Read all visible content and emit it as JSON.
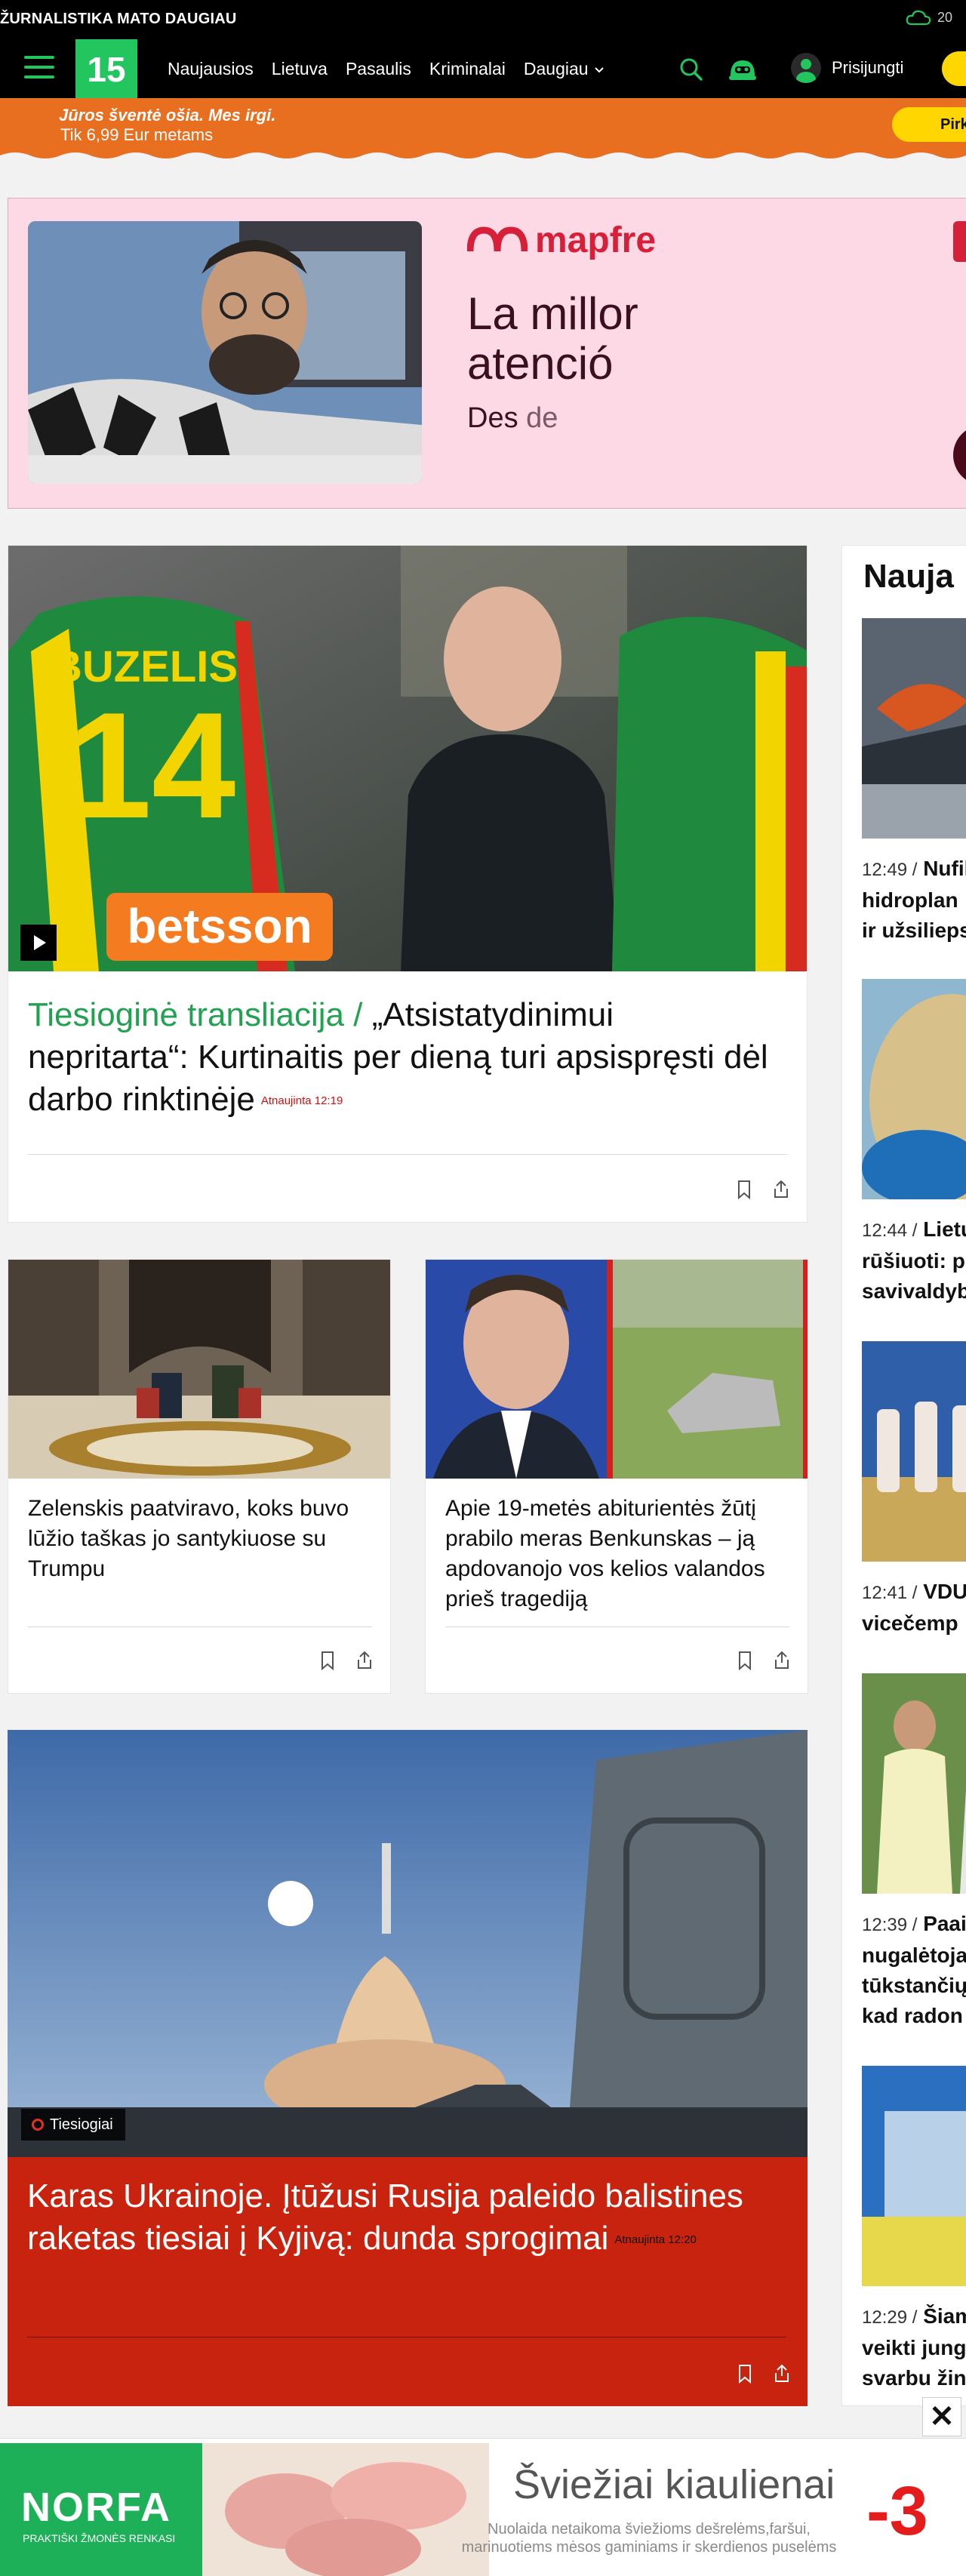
{
  "topbar": {
    "tagline": "ŽURNALISTIKA MATO DAUGIAU",
    "weather_temp": "20"
  },
  "nav": {
    "logo": "15",
    "items": [
      "Naujausios",
      "Lietuva",
      "Pasaulis",
      "Kriminalai",
      "Daugiau"
    ],
    "login": "Prisijungti"
  },
  "promo": {
    "line1": "Jūros šventė ošia. Mes irgi.",
    "line2": "Tik 6,99 Eur metams",
    "cta": "Pirk"
  },
  "ad": {
    "brand": "mapfre",
    "headline_1": "La millor",
    "headline_2": "atenció",
    "desc_1": "Des",
    "desc_2": "de"
  },
  "hero": {
    "live_label": "Tiesioginė transliacija /",
    "title": "„Atsistatydinimui nepritarta“: Kurtinaitis per dieną turi apsispręsti dėl darbo rinktinėje",
    "updated": "Atnaujinta 12:19"
  },
  "sidebar": {
    "title": "Nauja",
    "items": [
      {
        "time": "12:49 /",
        "lines": [
          "Nufil",
          "hidroplan",
          "ir užsilieps"
        ]
      },
      {
        "time": "12:44 /",
        "lines": [
          "Lietu",
          "rūšiuoti: p",
          "savivaldyb"
        ]
      },
      {
        "time": "12:41 /",
        "lines": [
          "VDU",
          "vicečemp"
        ]
      },
      {
        "time": "12:39 /",
        "lines": [
          "Paai",
          "nugalėtoja",
          "tūkstančių",
          "kad radon"
        ]
      },
      {
        "time": "12:29 /",
        "lines": [
          "Šiam",
          "veikti jung",
          "svarbu žin"
        ]
      }
    ]
  },
  "cards": [
    {
      "title": "Zelenskis paatviravo, koks buvo lūžio taškas jo santykiuose su Trumpu"
    },
    {
      "title": "Apie 19-metės abiturientės žūtį prabilo meras Benkunskas – ją apdovanojo vos kelios valandos prieš tragediją"
    }
  ],
  "war": {
    "label": "Tiesiogiai",
    "title": "Karas Ukrainoje. Įtūžusi Rusija paleido balistines raketas tiesiai į Kyjivą: dunda sprogimai",
    "updated": "Atnaujinta 12:20"
  },
  "bottom_ad": {
    "brand": "NORFA",
    "brand_sub": "PRAKTIŠKI ŽMONĖS RENKASI",
    "headline": "Šviežiai kiaulienai",
    "note": "Nuolaida netaikoma šviežioms dešrelėms,faršui, marinuotiems mėsos gaminiams ir skerdienos puselėms",
    "discount": "-3"
  },
  "colors": {
    "brand_green": "#22c55e",
    "live_green": "#22a150",
    "accent_red": "#c8230f",
    "promo_orange": "#e86f1f",
    "cta_yellow": "#ffd600"
  },
  "icons": [
    "menu-icon",
    "search-icon",
    "robot-icon",
    "user-icon",
    "play-icon",
    "bookmark-icon",
    "share-icon",
    "close-icon",
    "cloud-icon",
    "chevron-down-icon"
  ]
}
